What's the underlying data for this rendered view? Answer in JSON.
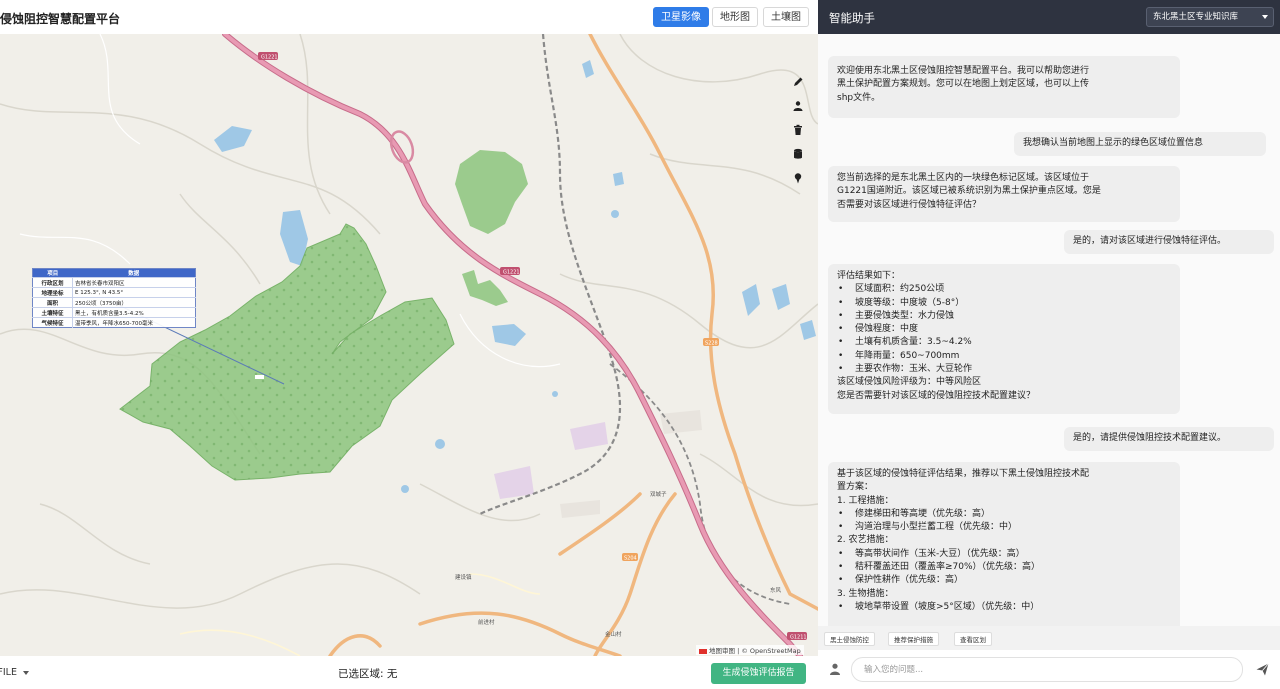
{
  "app": {
    "title": "侵蚀阻控智慧配置平台"
  },
  "map_toolbar": {
    "layers": [
      {
        "label": "卫星影像",
        "active": true
      },
      {
        "label": "地形图",
        "active": false
      },
      {
        "label": "土壤图",
        "active": false
      }
    ],
    "tools": [
      {
        "icon": "pencil-icon"
      },
      {
        "icon": "upload-icon"
      },
      {
        "icon": "trash-icon"
      },
      {
        "icon": "database-icon"
      },
      {
        "icon": "map-pin-icon"
      }
    ]
  },
  "map": {
    "road_labels": {
      "g1221_a": "G1221",
      "g1221_b": "G1221",
      "s228": "S228",
      "s204": "S204",
      "g1211": "G1211"
    },
    "place_labels": [
      "双城子",
      "东风",
      "前进村",
      "金山村",
      "建设镇"
    ],
    "info_table": {
      "headers": [
        "项目",
        "数据"
      ],
      "rows": [
        {
          "k": "行政区划",
          "v": "吉林省长春市双阳区"
        },
        {
          "k": "地理坐标",
          "v": "E 125.3°, N 43.5°"
        },
        {
          "k": "面积",
          "v": "250公顷（3750亩）"
        },
        {
          "k": "土壤特征",
          "v": "黑土，有机质含量3.5-4.2%"
        },
        {
          "k": "气候特征",
          "v": "温带季风，年降水650-700毫米"
        }
      ]
    },
    "attribution": "地图审图 | © OpenStreetMap"
  },
  "bottom_bar": {
    "select_value": "SHAPEFILE",
    "selected_area": "已选区域: 无",
    "report_button": "生成侵蚀评估报告"
  },
  "chat": {
    "title": "智能助手",
    "kb_select": "东北黑土区专业知识库",
    "messages": [
      {
        "role": "bot",
        "lines": [
          "欢迎使用东北黑土区侵蚀阻控智慧配置平台。我可以帮助您进行",
          "黑土保护配置方案规划。您可以在地图上划定区域，也可以上传",
          "shp文件。"
        ]
      },
      {
        "role": "user",
        "lines": [
          "我想确认当前地图上显示的绿色区域位置信息"
        ]
      },
      {
        "role": "bot",
        "lines": [
          "您当前选择的是东北黑土区内的一块绿色标记区域。该区域位于",
          "G1221国道附近。该区域已被系统识别为黑土保护重点区域。您是",
          "否需要对该区域进行侵蚀特征评估？"
        ]
      },
      {
        "role": "user",
        "lines": [
          "是的，请对该区域进行侵蚀特征评估。"
        ]
      },
      {
        "role": "bot",
        "intro": "评估结果如下：",
        "bullets": [
          "区域面积：约250公顷",
          "坡度等级：中度坡（5-8°）",
          "主要侵蚀类型：水力侵蚀",
          "侵蚀程度：中度",
          "土壤有机质含量：3.5~4.2%",
          "年降雨量：650~700mm",
          "主要农作物：玉米、大豆轮作"
        ],
        "outro": [
          "该区域侵蚀风险评级为：中等风险区",
          "您是否需要针对该区域的侵蚀阻控技术配置建议？"
        ]
      },
      {
        "role": "user",
        "lines": [
          "是的，请提供侵蚀阻控技术配置建议。"
        ]
      },
      {
        "role": "bot",
        "lines": [
          "基于该区域的侵蚀特征评估结果，推荐以下黑土侵蚀阻控技术配",
          "置方案："
        ],
        "sections": [
          {
            "heading": "1. 工程措施：",
            "bullets": [
              "修建梯田和等高埂（优先级：高）",
              "沟道治理与小型拦蓄工程（优先级：中）"
            ]
          },
          {
            "heading": "2. 农艺措施：",
            "bullets": [
              "等高带状间作（玉米-大豆）（优先级：高）",
              "秸秆覆盖还田（覆盖率≥70%）（优先级：高）",
              "保护性耕作（优先级：高）"
            ]
          },
          {
            "heading": "3. 生物措施：",
            "bullets": [
              "坡地草带设置（坡度>5°区域）（优先级：中）"
            ]
          }
        ]
      }
    ],
    "quick_replies": [
      "黑土侵蚀防控",
      "推荐保护措施",
      "查看区划"
    ],
    "input_placeholder": "输入您的问题..."
  },
  "colors": {
    "accent_blue": "#2f7ce8",
    "report_green": "#41b583",
    "header_dark": "#2e3340",
    "highway_pink": "#d98aa3",
    "secondary_orange": "#f0b77f",
    "area_green": "#8cc47c",
    "water_blue": "#9fc8e6"
  }
}
